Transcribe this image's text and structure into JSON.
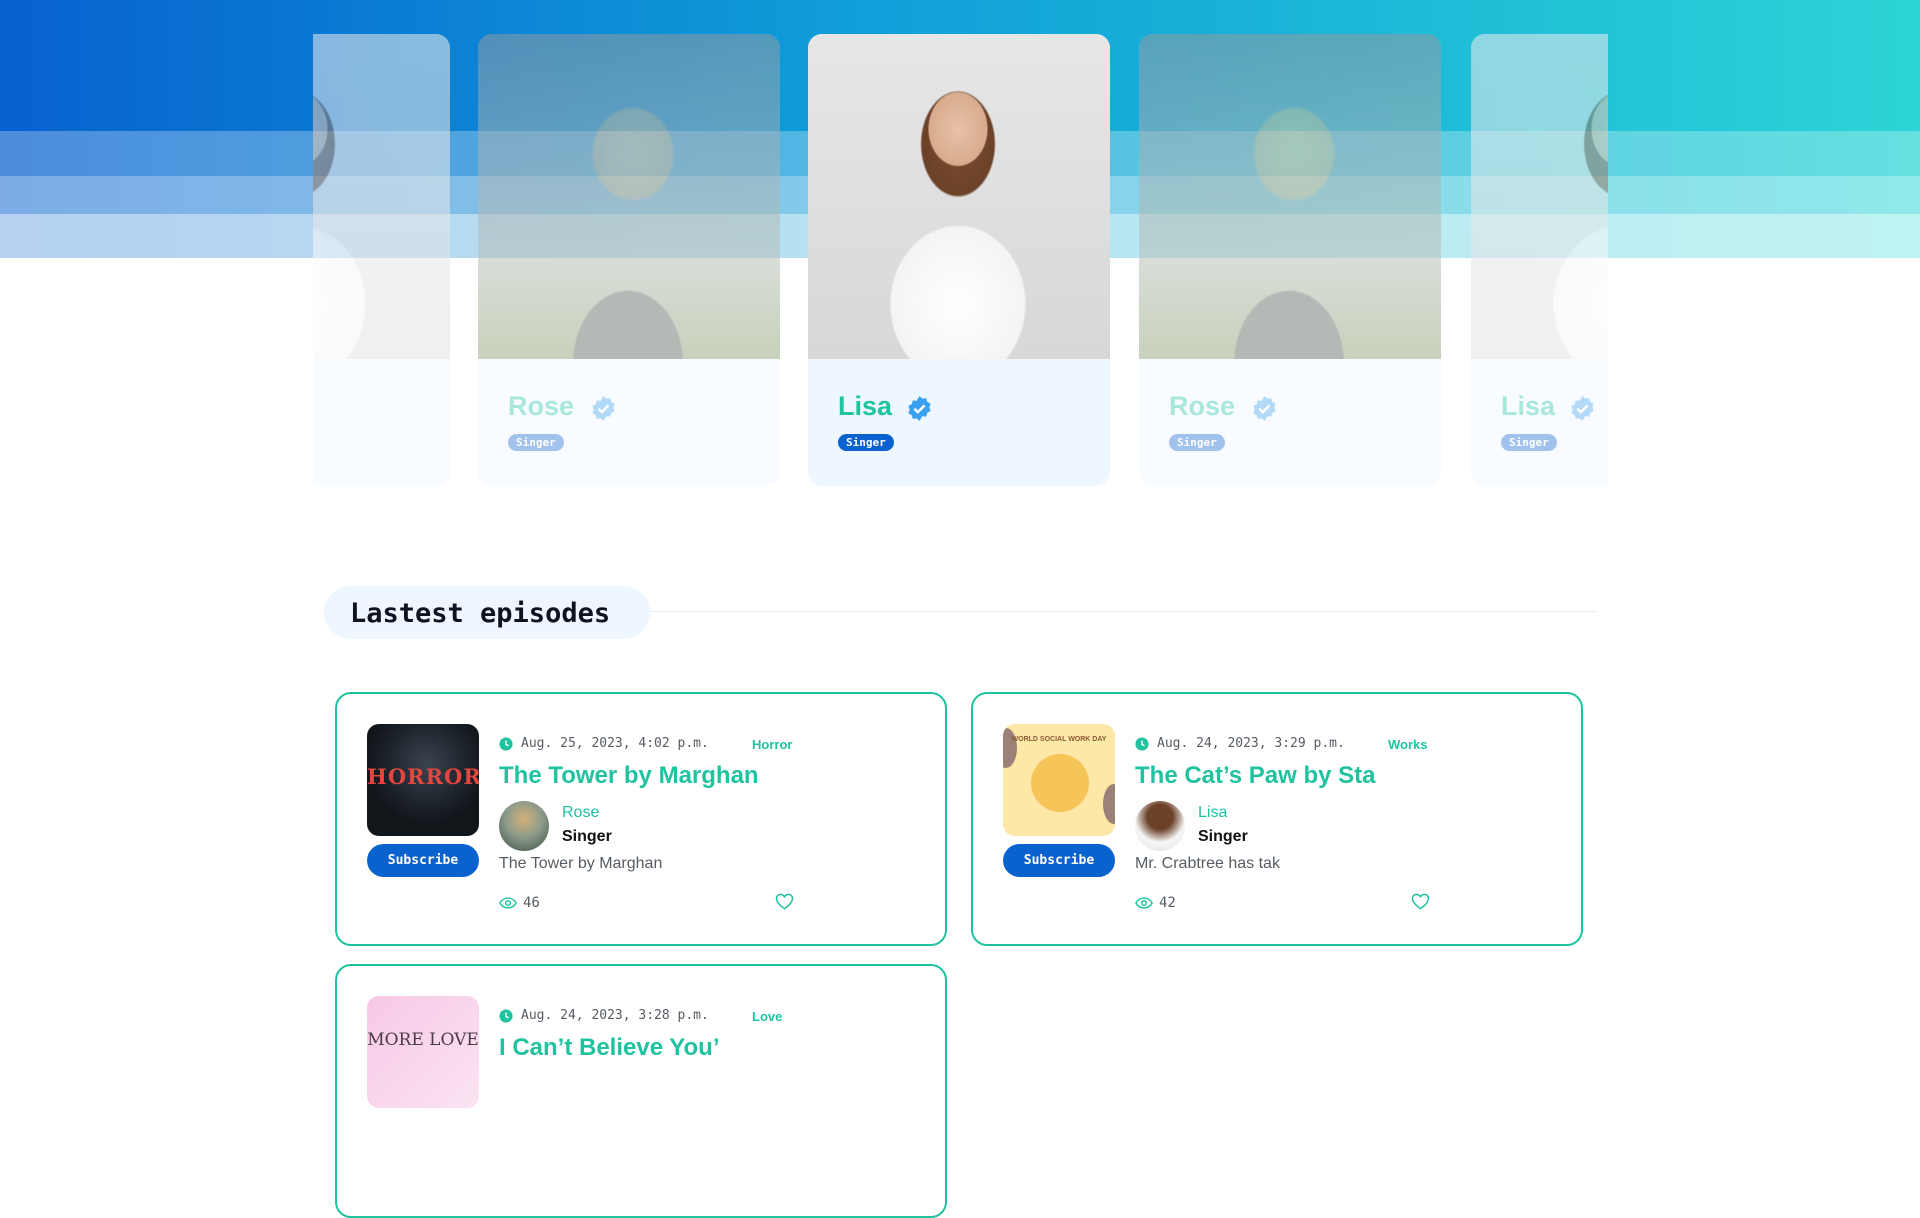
{
  "artists": [
    {
      "name": "Rose",
      "role": "Singer"
    },
    {
      "name": "Lisa",
      "role": "Singer"
    },
    {
      "name": "Rose",
      "role": "Singer"
    },
    {
      "name": "Lisa",
      "role": "Singer"
    }
  ],
  "latest": {
    "title": "Lastest episodes",
    "subscribe_label": "Subscribe",
    "episodes": [
      {
        "date": "Aug. 25, 2023, 4:02 p.m.",
        "category": "Horror",
        "title": "The Tower by Marghan",
        "host": "Rose",
        "host_role": "Singer",
        "description": "The Tower by Marghan",
        "views": "46",
        "cover_text": "HORROR"
      },
      {
        "date": "Aug. 24, 2023, 3:29 p.m.",
        "category": "Works",
        "title": "The Cat’s Paw by Sta",
        "host": "Lisa",
        "host_role": "Singer",
        "description": "Mr. Crabtree has tak",
        "views": "42",
        "cover_text": "WORLD SOCIAL WORK DAY"
      },
      {
        "date": "Aug. 24, 2023, 3:28 p.m.",
        "category": "Love",
        "title": "I Can’t Believe You’",
        "cover_text": "MORE LOVE"
      }
    ]
  },
  "colors": {
    "accent": "#1fc3a0",
    "primary": "#0a62cf",
    "verified": "#3aa0f0"
  },
  "icons": {
    "verified": "verified-badge-icon",
    "clock": "clock-icon",
    "views": "eye-icon",
    "like": "heart-icon"
  }
}
